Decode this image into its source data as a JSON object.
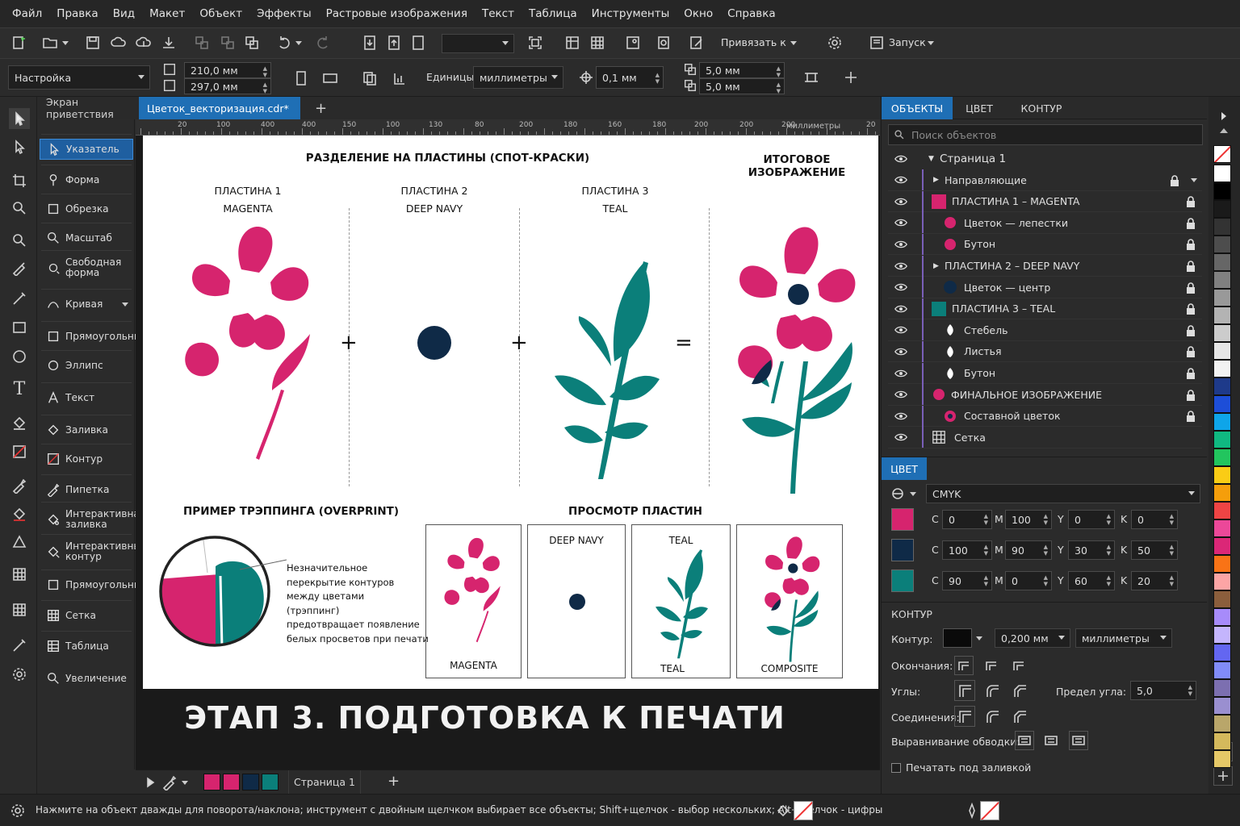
{
  "menu": [
    "Файл",
    "Правка",
    "Вид",
    "Макет",
    "Объект",
    "Эффекты",
    "Растровые изображения",
    "Текст",
    "Таблица",
    "Инструменты",
    "Окно",
    "Справка"
  ],
  "toolbar": {
    "snap_label": "Привязать к",
    "launch_label": "Запуск"
  },
  "propbar": {
    "preset": "Настройка",
    "width": "210,0 мм",
    "height": "297,0 мм",
    "units_label": "Единицы:",
    "units": "миллиметры",
    "nudge": "0,1 мм",
    "dup_x": "5,0 мм",
    "dup_y": "5,0 мм"
  },
  "tabs": [
    "Экран приветствия",
    "Цветок_векторизация.cdr*"
  ],
  "ruler": {
    "ticks": [
      "20",
      "100",
      "400",
      "400",
      "150",
      "100",
      "130",
      "80",
      "200",
      "180",
      "160",
      "180",
      "200",
      "200",
      "200",
      "20"
    ],
    "unit": "миллиметры"
  },
  "flyout": [
    "Указатель",
    "Форма",
    "Обрезка",
    "Масштаб",
    "Свободная форма",
    "Кривая",
    "Прямоугольник",
    "Эллипс",
    "Текст",
    "Заливка",
    "Контур",
    "Пипетка",
    "Интерактивная заливка",
    "Интерактивный контур",
    "Прямоугольник",
    "Сетка",
    "Таблица",
    "Увеличение"
  ],
  "page": {
    "sep_title": "РАЗДЕЛЕНИЕ НА ПЛАСТИНЫ (СПОТ-КРАСКИ)",
    "final_title": "ИТОГОВОЕ ИЗОБРАЖЕНИЕ",
    "plate1": [
      "ПЛАСТИНА 1",
      "MAGENTA"
    ],
    "plate2": [
      "ПЛАСТИНА 2",
      "DEEP NAVY"
    ],
    "plate3": [
      "ПЛАСТИНА 3",
      "TEAL"
    ],
    "plus": "+",
    "equals": "=",
    "trap_title": "ПРИМЕР ТРЭППИНГА (OVERPRINT)",
    "trap_text": [
      "Незначительное",
      "перекрытие контуров",
      "между цветами",
      "(трэппинг)",
      "предотвращает появление",
      "белых просветов при печати"
    ],
    "preview_title": "ПРОСМОТР ПЛАСТИН",
    "preview_labels": [
      "MAGENTA",
      "DEEP NAVY",
      "TEAL",
      "TEAL",
      "COMPOSITE"
    ]
  },
  "overlay_title": "ЭТАП 3. ПОДГОТОВКА К ПЕЧАТИ",
  "pagebar": {
    "page": "Страница 1",
    "plus": "+"
  },
  "status": "Нажмите на объект дважды для поворота/наклона; инструмент с двойным щелчком выбирает все объекты; Shift+щелчок - выбор нескольких; Alt+щелчок - цифры",
  "objects_panel": {
    "tabs": [
      "ОБЪЕКТЫ",
      "ЦВЕТ",
      "КОНТУР"
    ],
    "search_placeholder": "Поиск объектов",
    "items": [
      "Страница 1",
      "Направляющие",
      "ПЛАСТИНА 1 – MAGENTA",
      "Цветок — лепестки",
      "Бутон",
      "ПЛАСТИНА 2 – DEEP NAVY",
      "Цветок — центр",
      "ПЛАСТИНА 3 – TEAL",
      "Стебель",
      "Листья",
      "Бутон",
      "ФИНАЛЬНОЕ ИЗОБРАЖЕНИЕ",
      "Составной цветок",
      "Сетка"
    ]
  },
  "color_panel": {
    "title": "ЦВЕТ",
    "model": "CMYK",
    "rows": [
      {
        "swatch": "#d6246e",
        "C": "0",
        "M": "100",
        "Y": "0",
        "K": "0"
      },
      {
        "swatch": "#0f2a47",
        "C": "100",
        "M": "90",
        "Y": "30",
        "K": "50"
      },
      {
        "swatch": "#0b7f7a",
        "C": "90",
        "M": "0",
        "Y": "60",
        "K": "20"
      }
    ],
    "letters": [
      "C",
      "M",
      "Y",
      "K"
    ]
  },
  "contour_panel": {
    "title": "КОНТУР",
    "outline_label": "Контур:",
    "width": "0,200 мм",
    "units": "миллиметры",
    "ends_label": "Окончания:",
    "corners_label": "Углы:",
    "miter_label": "Предел угла:",
    "miter": "5,0",
    "joins_label": "Соединения:",
    "align_label": "Выравнивание обводки:",
    "overprint_label": "Печатать под заливкой"
  },
  "colors": {
    "magenta": "#d6246e",
    "navy": "#0f2a47",
    "teal": "#0b7f7a",
    "accent": "#1f6fb5"
  },
  "palette": [
    "#ffffff",
    "#000000",
    "#1a1a1a",
    "#333333",
    "#4d4d4d",
    "#666666",
    "#808080",
    "#999999",
    "#b3b3b3",
    "#cccccc",
    "#e6e6e6",
    "#f2f2f2",
    "#1e3a8a",
    "#1d4ed8",
    "#0ea5e9",
    "#10b981",
    "#22c55e",
    "#facc15",
    "#f59e0b",
    "#ef4444",
    "#ec4899",
    "#db2777",
    "#f97316",
    "#fca5a5",
    "#8b5e3c",
    "#a78bfa",
    "#c4b5fd",
    "#6366f1",
    "#818cf8",
    "#7c6fb0",
    "#9a8fd0",
    "#b9a66a",
    "#d4b95c",
    "#e5c867"
  ]
}
